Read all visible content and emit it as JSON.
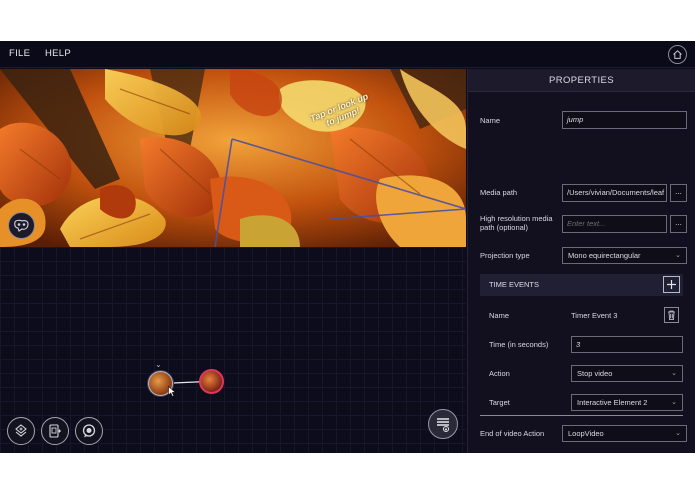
{
  "menubar": {
    "file": "FILE",
    "help": "HELP",
    "home_icon": "home-icon"
  },
  "viewport": {
    "hint_line1": "Tap or look up",
    "hint_line2": "to jump!",
    "vr_icon": "vr-headset-icon"
  },
  "graph": {
    "nodes": [
      {
        "id": "video-node-1"
      },
      {
        "id": "video-node-2"
      }
    ],
    "tools": [
      "add-scene-icon",
      "add-element-icon",
      "chat-bubble-icon"
    ],
    "layers_icon": "layers-icon"
  },
  "panel": {
    "title": "PROPERTIES",
    "name_label": "Name",
    "name_value": "jump",
    "media_path_label": "Media path",
    "media_path_value": "/Users/vivian/Documents/leaf",
    "media_path_button": "...",
    "hires_label_line1": "High resolution media",
    "hires_label_line2": "path (optional)",
    "hires_placeholder": "Enter text...",
    "hires_button": "...",
    "projection_label": "Projection type",
    "projection_value": "Mono equirectangular",
    "time_events": {
      "header": "TIME EVENTS",
      "name_label": "Name",
      "name_value": "Timer Event 3",
      "time_label": "Time (in seconds)",
      "time_value": "3",
      "action_label": "Action",
      "action_value": "Stop video",
      "target_label": "Target",
      "target_value": "Interactive Element 2"
    },
    "end_label": "End of video Action",
    "end_value": "LoopVideo"
  },
  "colors": {
    "app_bg": "#0d0c1a",
    "panel_bg": "#12101f",
    "accent_node": "#e0355e",
    "leaf_orange": "#e8822a"
  }
}
